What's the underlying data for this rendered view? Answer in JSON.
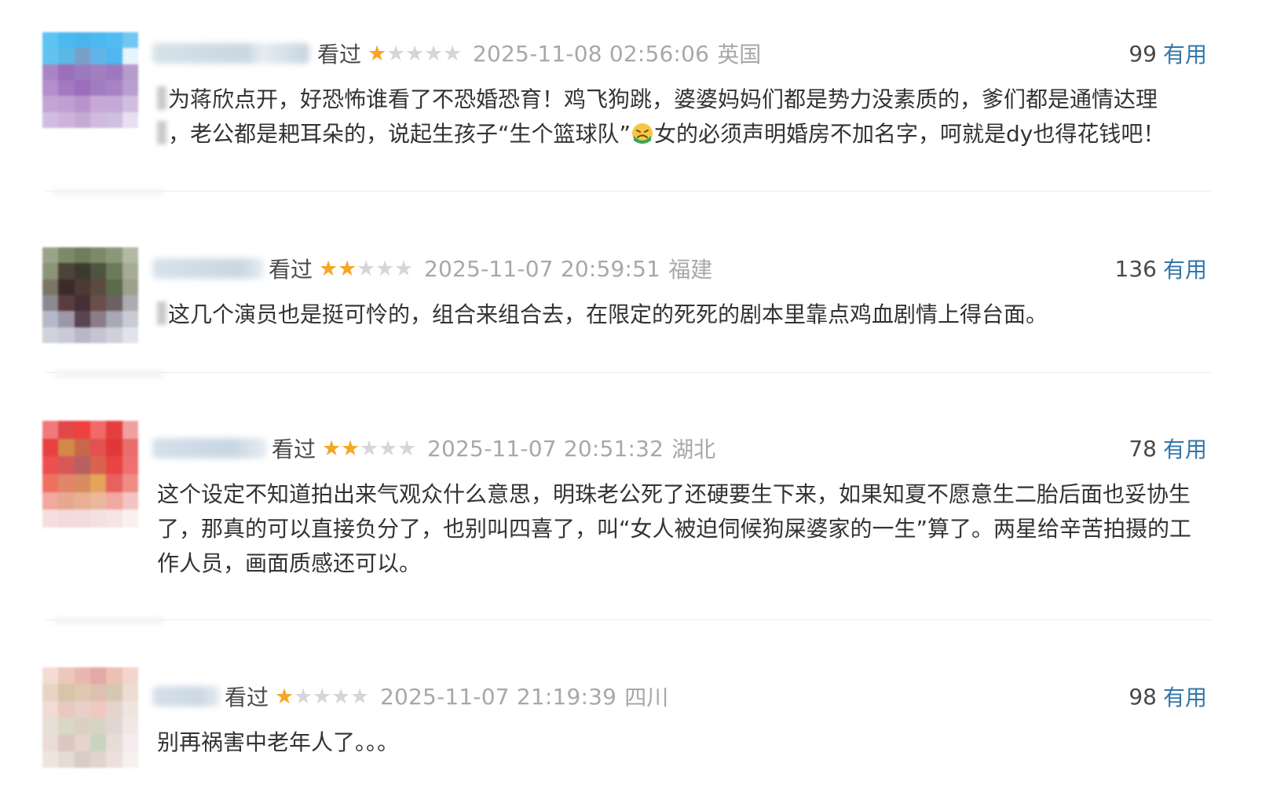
{
  "comments": [
    {
      "watched": "看过",
      "rating": 1,
      "time": "2025-11-08 02:56:06",
      "location": "英国",
      "votes": "99",
      "useful": "有用",
      "lines": [
        "为蒋欣点开，好恐怖谁看了不恐婚恐育！鸡飞狗跳，婆婆妈妈们都是势力没素质的，爹们都是通情达理",
        "，老公都是耙耳朵的，说起生孩子“生个篮球队”",
        "女的必须声明婚房不加名字，呵就是dy也得花钱吧！"
      ],
      "emoji": "crying-face-emoji",
      "avatar_colors": [
        "#4cb8f0",
        "#9b7bc0",
        "#c9a6d6"
      ]
    },
    {
      "watched": "看过",
      "rating": 2,
      "time": "2025-11-07 20:59:51",
      "location": "福建",
      "votes": "136",
      "useful": "有用",
      "lines": [
        "这几个演员也是挺可怜的，组合来组合去，在限定的死死的剧本里靠点鸡血剧情上得台面。"
      ],
      "avatar_colors": [
        "#7a8a6a",
        "#4a3a3a",
        "#b0b4c6"
      ]
    },
    {
      "watched": "看过",
      "rating": 2,
      "time": "2025-11-07 20:51:32",
      "location": "湖北",
      "votes": "78",
      "useful": "有用",
      "lines": [
        "这个设定不知道拍出来气观众什么意思，明珠老公死了还硬要生下来，如果知夏不愿意生二胎后面也妥协生",
        "了，那真的可以直接负分了，也别叫四喜了，叫“女人被迫伺候狗屎婆家的一生”算了。两星给辛苦拍摄的工",
        "作人员，画面质感还可以。"
      ],
      "avatar_colors": [
        "#e83838",
        "#d4884a",
        "#f0c8c8"
      ]
    },
    {
      "watched": "看过",
      "rating": 1,
      "time": "2025-11-07 21:19:39",
      "location": "四川",
      "votes": "98",
      "useful": "有用",
      "lines": [
        "别再祸害中老年人了。。。"
      ],
      "avatar_colors": [
        "#e8c8c0",
        "#d8d0c0",
        "#c8d4c0"
      ]
    }
  ],
  "colors": {
    "star_on": "#f5a623",
    "star_off": "#d6d6d6",
    "useful_link": "#3377aa",
    "meta_gray": "#a8a8a8",
    "text": "#333333"
  }
}
